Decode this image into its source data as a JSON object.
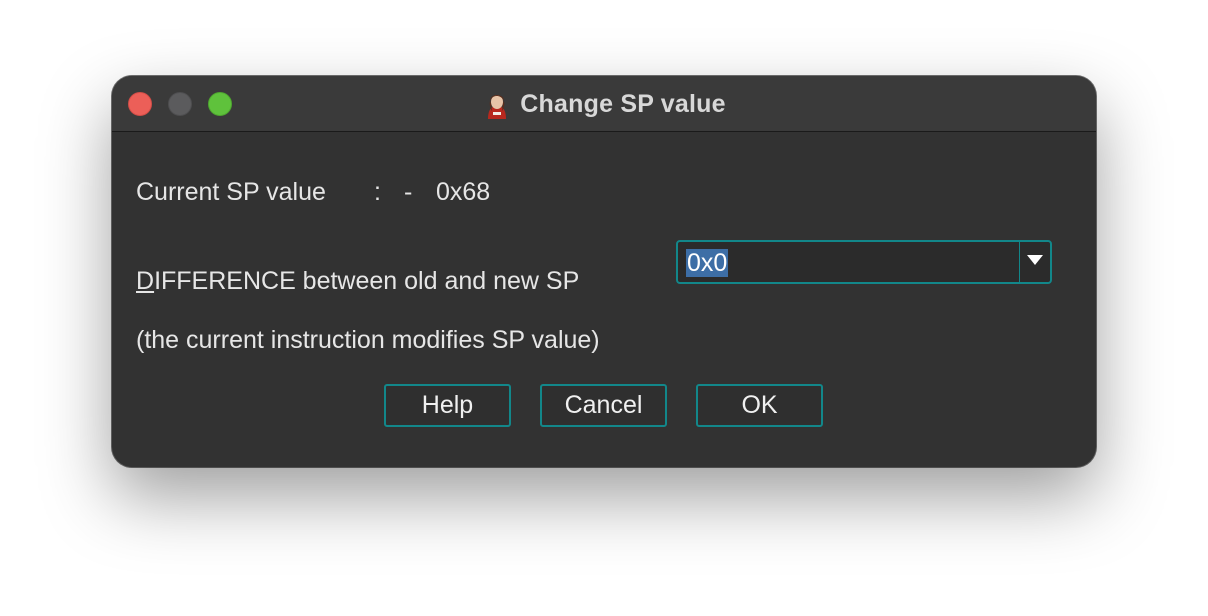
{
  "window": {
    "title": "Change SP value",
    "app_icon": "portrait-icon"
  },
  "controls": {
    "close": "close-button",
    "minimize": "minimize-button",
    "zoom": "zoom-button"
  },
  "current": {
    "label": "Current SP value",
    "colon": ":",
    "dash": "-",
    "value": "0x68"
  },
  "difference": {
    "label_mnemonic": "D",
    "label_rest": "IFFERENCE between old and new SP",
    "value": "0x0",
    "dropdown_icon": "chevron-down-icon"
  },
  "note": "(the current instruction modifies SP value)",
  "buttons": {
    "help": "Help",
    "cancel": "Cancel",
    "ok": "OK"
  },
  "colors": {
    "accent": "#12878a",
    "selection": "#3d6ea6",
    "background": "#323232"
  }
}
